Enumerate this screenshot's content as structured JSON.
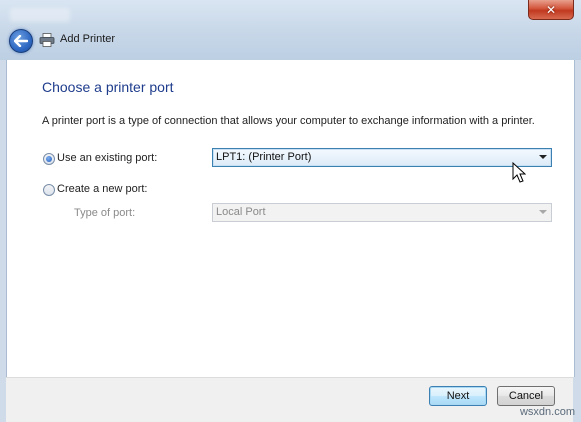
{
  "window": {
    "close_glyph": "✕",
    "title": "Add Printer"
  },
  "page": {
    "heading": "Choose a printer port",
    "description": "A printer port is a type of connection that allows your computer to exchange information with a printer."
  },
  "options": {
    "existing_port": {
      "label": "Use an existing port:",
      "checked": true,
      "selected_value": "LPT1: (Printer Port)"
    },
    "new_port": {
      "label": "Create a new port:",
      "checked": false,
      "type_label": "Type of port:",
      "type_value": "Local Port"
    }
  },
  "buttons": {
    "next": "Next",
    "cancel": "Cancel"
  },
  "watermark": "wsxdn.com",
  "colors": {
    "heading": "#1e3c8c",
    "close_button": "#c0381f",
    "back_button": "#2f69c3"
  },
  "icons": [
    "back-arrow-icon",
    "printer-icon",
    "close-icon",
    "mouse-cursor-icon",
    "dropdown-arrow-icon"
  ]
}
